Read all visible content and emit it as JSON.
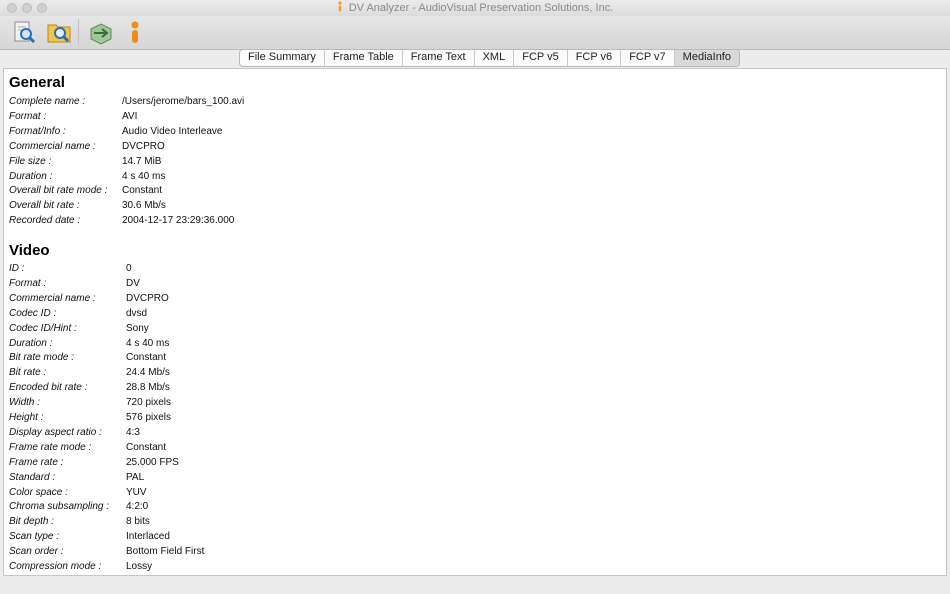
{
  "window": {
    "title": "DV Analyzer - AudioVisual Preservation Solutions, Inc."
  },
  "toolbar": {
    "buttons": [
      "open-file-icon",
      "open-folder-icon",
      "export-icon",
      "avpreserve-logo-icon"
    ]
  },
  "tabs": [
    {
      "label": "File Summary",
      "active": false
    },
    {
      "label": "Frame Table",
      "active": false
    },
    {
      "label": "Frame Text",
      "active": false
    },
    {
      "label": "XML",
      "active": false
    },
    {
      "label": "FCP v5",
      "active": false
    },
    {
      "label": "FCP v6",
      "active": false
    },
    {
      "label": "FCP v7",
      "active": false
    },
    {
      "label": "MediaInfo",
      "active": true
    }
  ],
  "general": {
    "title": "General",
    "rows": [
      {
        "key": "Complete name :",
        "value": "/Users/jerome/bars_100.avi"
      },
      {
        "key": "Format :",
        "value": "AVI"
      },
      {
        "key": "Format/Info :",
        "value": "Audio Video Interleave"
      },
      {
        "key": "Commercial name :",
        "value": "DVCPRO"
      },
      {
        "key": "File size :",
        "value": "14.7 MiB"
      },
      {
        "key": "Duration :",
        "value": "4 s 40 ms"
      },
      {
        "key": "Overall bit rate mode :",
        "value": "Constant"
      },
      {
        "key": "Overall bit rate :",
        "value": "30.6 Mb/s"
      },
      {
        "key": "Recorded date :",
        "value": "2004-12-17 23:29:36.000"
      }
    ]
  },
  "video": {
    "title": "Video",
    "rows": [
      {
        "key": "ID :",
        "value": "0"
      },
      {
        "key": "Format :",
        "value": "DV"
      },
      {
        "key": "Commercial name :",
        "value": "DVCPRO"
      },
      {
        "key": "Codec ID :",
        "value": "dvsd"
      },
      {
        "key": "Codec ID/Hint :",
        "value": "Sony"
      },
      {
        "key": "Duration :",
        "value": "4 s 40 ms"
      },
      {
        "key": "Bit rate mode :",
        "value": "Constant"
      },
      {
        "key": "Bit rate :",
        "value": "24.4 Mb/s"
      },
      {
        "key": "Encoded bit rate :",
        "value": "28.8 Mb/s"
      },
      {
        "key": "Width :",
        "value": "720 pixels"
      },
      {
        "key": "Height :",
        "value": "576 pixels"
      },
      {
        "key": "Display aspect ratio :",
        "value": "4:3"
      },
      {
        "key": "Frame rate mode :",
        "value": "Constant"
      },
      {
        "key": "Frame rate :",
        "value": "25.000 FPS"
      },
      {
        "key": "Standard :",
        "value": "PAL"
      },
      {
        "key": "Color space :",
        "value": "YUV"
      },
      {
        "key": "Chroma subsampling :",
        "value": "4:2:0"
      },
      {
        "key": "Bit depth :",
        "value": "8 bits"
      },
      {
        "key": "Scan type :",
        "value": "Interlaced"
      },
      {
        "key": "Scan order :",
        "value": "Bottom Field First"
      },
      {
        "key": "Compression mode :",
        "value": "Lossy"
      }
    ]
  }
}
